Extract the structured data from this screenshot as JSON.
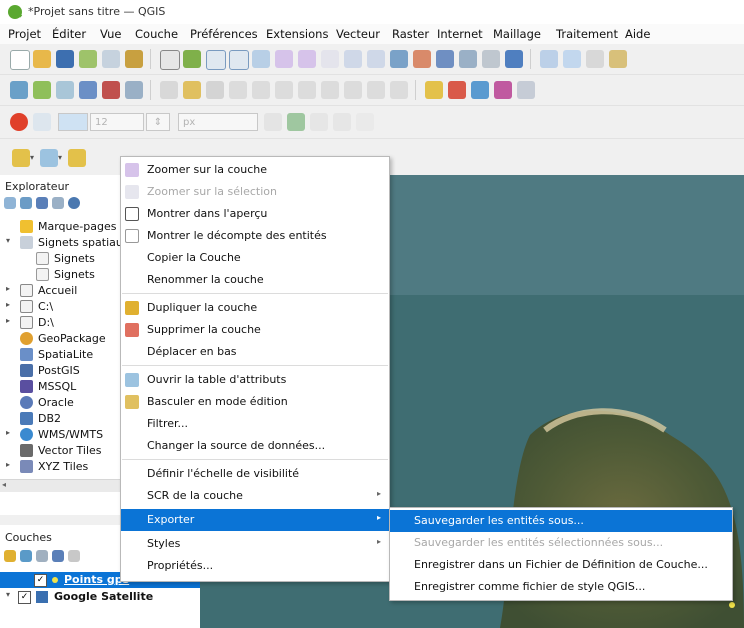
{
  "window": {
    "title": "*Projet sans titre — QGIS"
  },
  "menubar": [
    "Projet",
    "Éditer",
    "Vue",
    "Couche",
    "Préférences",
    "Extensions",
    "Vecteur",
    "Raster",
    "Internet",
    "Maillage",
    "Traitement",
    "Aide"
  ],
  "style_toolbar": {
    "size_value": "12",
    "unit_value": "px"
  },
  "explorer": {
    "title": "Explorateur",
    "items": [
      "Marque-pages",
      "Signets spatiaux",
      "Signets",
      "Signets",
      "Accueil",
      "C:\\",
      "D:\\",
      "GeoPackage",
      "SpatiaLite",
      "PostGIS",
      "MSSQL",
      "Oracle",
      "DB2",
      "WMS/WMTS",
      "Vector Tiles",
      "XYZ Tiles"
    ]
  },
  "layers": {
    "title": "Couches",
    "items": [
      "Points gps",
      "Google Satellite"
    ]
  },
  "context_menu": {
    "items": [
      "Zoomer sur la couche",
      "Zoomer sur la sélection",
      "Montrer dans l'aperçu",
      "Montrer le décompte des entités",
      "Copier la Couche",
      "Renommer la couche",
      "Dupliquer la couche",
      "Supprimer la couche",
      "Déplacer en bas",
      "Ouvrir la table d'attributs",
      "Basculer en mode édition",
      "Filtrer...",
      "Changer la source de données...",
      "Définir l'échelle de visibilité",
      "SCR de la couche",
      "Exporter",
      "Styles",
      "Propriétés..."
    ]
  },
  "export_submenu": {
    "items": [
      "Sauvegarder les entités sous...",
      "Sauvegarder les entités sélectionnées sous...",
      "Enregistrer dans un Fichier de Définition de Couche...",
      "Enregistrer comme fichier de style QGIS..."
    ]
  }
}
